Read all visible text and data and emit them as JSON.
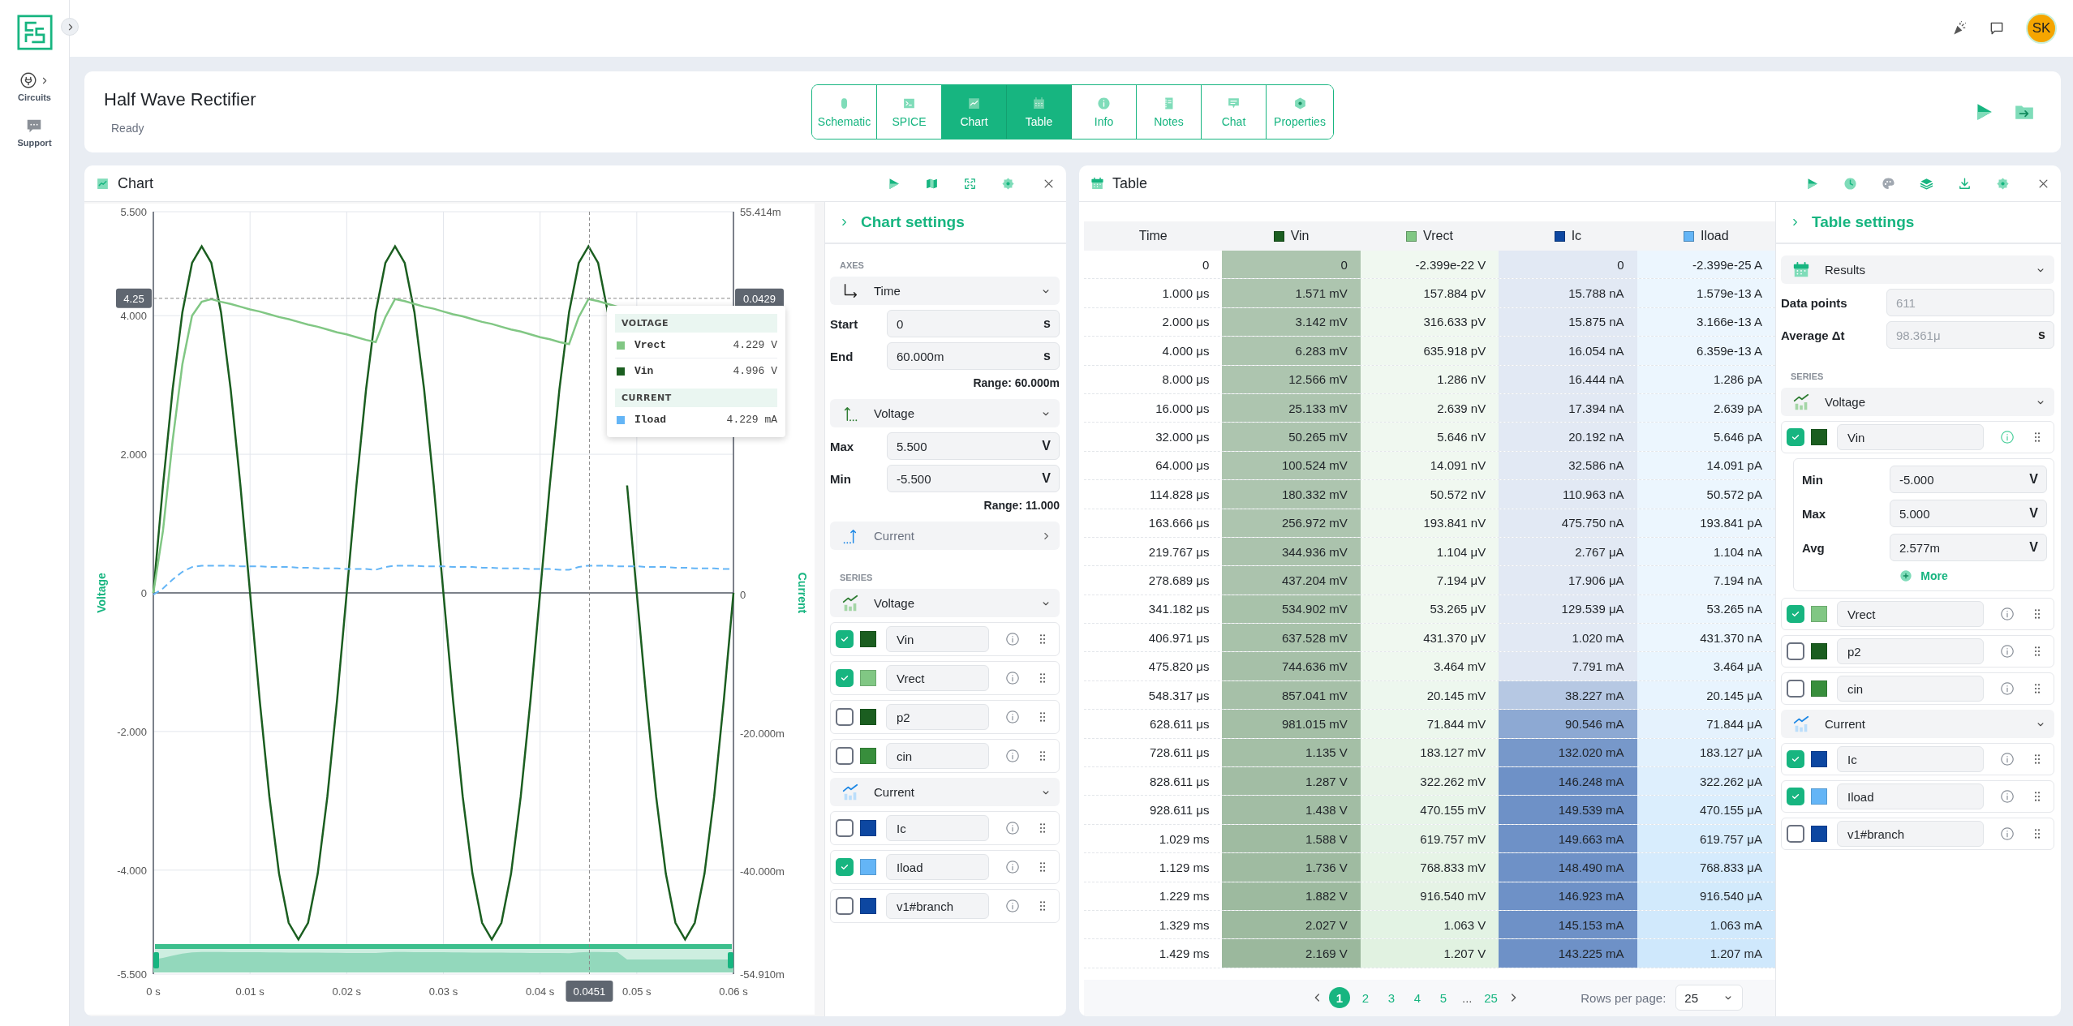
{
  "sidebar": {
    "items": [
      {
        "label": "Circuits",
        "kind": "circuits"
      },
      {
        "label": "Support",
        "kind": "support"
      }
    ]
  },
  "topbar": {
    "avatar": "SK"
  },
  "project": {
    "title": "Half Wave Rectifier",
    "status": "Ready",
    "tabs": [
      {
        "label": "Schematic",
        "selected": false
      },
      {
        "label": "SPICE",
        "selected": false
      },
      {
        "label": "Chart",
        "selected": true
      },
      {
        "label": "Table",
        "selected": true
      },
      {
        "label": "Info",
        "selected": false
      },
      {
        "label": "Notes",
        "selected": false
      },
      {
        "label": "Chat",
        "selected": false
      },
      {
        "label": "Properties",
        "selected": false
      }
    ]
  },
  "chart_panel": {
    "title": "Chart",
    "chart_data": {
      "type": "line",
      "ylabel": "Voltage",
      "y2label": "Current",
      "xlim": [
        0,
        0.06
      ],
      "ylim": [
        -5.5,
        5.5
      ],
      "y2lim": [
        -54.91,
        55.414
      ],
      "xticks": [
        {
          "value": 0,
          "label": "0 s"
        },
        {
          "value": 0.01,
          "label": "0.01 s"
        },
        {
          "value": 0.02,
          "label": "0.02 s"
        },
        {
          "value": 0.03,
          "label": "0.03 s"
        },
        {
          "value": 0.04,
          "label": "0.04 s"
        },
        {
          "value": 0.05,
          "label": "0.05 s"
        },
        {
          "value": 0.06,
          "label": "0.06 s"
        }
      ],
      "yticks": [
        {
          "value": 5.5,
          "label": "5.500"
        },
        {
          "value": 4,
          "label": "4.000"
        },
        {
          "value": 2,
          "label": "2.000"
        },
        {
          "value": 0,
          "label": "0"
        },
        {
          "value": -2,
          "label": "-2.000"
        },
        {
          "value": -4,
          "label": "-4.000"
        },
        {
          "value": -5.5,
          "label": "-5.500"
        }
      ],
      "y2ticks": [
        {
          "value": 55.414,
          "label": "55.414m"
        },
        {
          "value": 0,
          "label": "0"
        },
        {
          "value": -20,
          "label": "-20.000m"
        },
        {
          "value": -40,
          "label": "-40.000m"
        },
        {
          "value": -54.91,
          "label": "-54.910m"
        }
      ],
      "x": [
        0,
        0.001,
        0.002,
        0.003,
        0.004,
        0.005,
        0.006,
        0.007,
        0.008,
        0.009,
        0.01,
        0.011,
        0.012,
        0.013,
        0.014,
        0.015,
        0.016,
        0.017,
        0.018,
        0.019,
        0.02,
        0.021,
        0.022,
        0.023,
        0.024,
        0.025,
        0.026,
        0.027,
        0.028,
        0.029,
        0.03,
        0.031,
        0.032,
        0.033,
        0.034,
        0.035,
        0.036,
        0.037,
        0.038,
        0.039,
        0.04,
        0.041,
        0.042,
        0.043,
        0.044,
        0.045,
        0.046,
        0.047,
        0.048,
        0.049,
        0.05,
        0.051,
        0.052,
        0.053,
        0.054,
        0.055,
        0.056,
        0.057,
        0.058,
        0.059,
        0.06
      ],
      "series": [
        {
          "color": "#1b5e20",
          "values": [
            0,
            1.55,
            2.94,
            4.05,
            4.76,
            5,
            4.76,
            4.05,
            2.94,
            1.55,
            0,
            -1.55,
            -2.94,
            -4.05,
            -4.76,
            -5,
            -4.76,
            -4.05,
            -2.94,
            -1.55,
            0,
            1.55,
            2.94,
            4.05,
            4.76,
            5,
            4.76,
            4.05,
            2.94,
            1.55,
            0,
            -1.55,
            -2.94,
            -4.05,
            -4.76,
            -5,
            -4.76,
            -4.05,
            -2.94,
            -1.55,
            0,
            1.55,
            2.94,
            4.05,
            4.76,
            5,
            4.76,
            4.05,
            null,
            1.55,
            0,
            -1.55,
            -2.94,
            -4.05,
            -4.76,
            -5,
            -4.76,
            -4.05,
            -2.94,
            -1.55,
            0
          ]
        },
        {
          "color": "#81c784",
          "values": [
            0,
            0.9,
            2.2,
            3.3,
            4,
            4.2,
            4.24,
            4.2,
            4.17,
            4.13,
            4.09,
            4.06,
            4.02,
            3.98,
            3.95,
            3.91,
            3.87,
            3.84,
            3.8,
            3.76,
            3.73,
            3.69,
            3.65,
            3.62,
            3.98,
            4.24,
            4.21,
            4.17,
            4.13,
            4.1,
            4.06,
            4.02,
            3.99,
            3.95,
            3.91,
            3.88,
            3.84,
            3.8,
            3.77,
            3.73,
            3.69,
            3.66,
            3.62,
            3.59,
            3.98,
            4.24,
            4.21,
            4.17,
            4.13,
            null,
            null,
            null,
            null,
            null,
            null,
            null,
            null,
            null,
            null,
            null,
            null
          ]
        },
        {
          "color": "#64b5f6",
          "axis": "y2",
          "line_style": "dashed",
          "values": [
            0,
            0.9,
            2.2,
            3.3,
            4,
            4.2,
            4.2,
            4.2,
            4.2,
            4.1,
            4.1,
            4.1,
            4,
            4,
            4,
            3.9,
            3.9,
            3.8,
            3.8,
            3.8,
            3.7,
            3.7,
            3.7,
            3.6,
            4,
            4.2,
            4.2,
            4.2,
            4.1,
            4.1,
            4.1,
            4,
            4,
            4,
            3.9,
            3.9,
            3.8,
            3.8,
            3.8,
            3.7,
            3.7,
            3.7,
            3.6,
            3.6,
            4,
            4.2,
            4.2,
            4.2,
            4.1,
            4.1,
            4.1,
            4,
            4,
            4,
            3.9,
            3.9,
            3.8,
            3.8,
            3.8,
            3.7,
            3.7
          ]
        }
      ],
      "grid": true,
      "ref_lines": [
        {
          "axis": "x",
          "value": 0.0451,
          "label": "0.0451"
        },
        {
          "axis": "y",
          "value": 4.25,
          "label": "4.25"
        }
      ],
      "annotations": [
        "0.0429"
      ]
    },
    "tooltip": {
      "groups": [
        {
          "title": "VOLTAGE",
          "items": [
            {
              "name": "Vrect",
              "value": "4.229 V",
              "color": "#81c784"
            },
            {
              "name": "Vin",
              "value": "4.996 V",
              "color": "#1b5e20"
            }
          ]
        },
        {
          "title": "CURRENT",
          "items": [
            {
              "name": "Iload",
              "value": "4.229 mA",
              "color": "#64b5f6"
            }
          ]
        }
      ]
    },
    "settings": {
      "title": "Chart settings",
      "axes_heading": "AXES",
      "axes": [
        {
          "label": "Time",
          "kind": "time",
          "expanded": true,
          "fields": [
            {
              "label": "Start",
              "value": "0",
              "unit": "s"
            },
            {
              "label": "End",
              "value": "60.000m",
              "unit": "s"
            }
          ],
          "range": "Range: 60.000m"
        },
        {
          "label": "Voltage",
          "kind": "voltage",
          "expanded": true,
          "fields": [
            {
              "label": "Max",
              "value": "5.500",
              "unit": "V"
            },
            {
              "label": "Min",
              "value": "-5.500",
              "unit": "V"
            }
          ],
          "range": "Range: 11.000"
        },
        {
          "label": "Current",
          "kind": "current",
          "expanded": false
        }
      ],
      "series_heading": "SERIES",
      "series_groups": [
        {
          "label": "Voltage",
          "kind": "voltage",
          "series": [
            {
              "name": "Vin",
              "checked": true,
              "color": "#1b5e20"
            },
            {
              "name": "Vrect",
              "checked": true,
              "color": "#81c784"
            },
            {
              "name": "p2",
              "checked": false,
              "color": "#1b5e20"
            },
            {
              "name": "cin",
              "checked": false,
              "color": "#388e3c"
            }
          ]
        },
        {
          "label": "Current",
          "kind": "current",
          "series": [
            {
              "name": "Ic",
              "checked": false,
              "color": "#0d47a1"
            },
            {
              "name": "Iload",
              "checked": true,
              "color": "#64b5f6"
            },
            {
              "name": "v1#branch",
              "checked": false,
              "color": "#0d47a1"
            }
          ]
        }
      ]
    }
  },
  "table_panel": {
    "title": "Table",
    "table": {
      "time_column": "Time",
      "columns": [
        {
          "label": "Vin",
          "color": "#1b5e20"
        },
        {
          "label": "Vrect",
          "color": "#81c784"
        },
        {
          "label": "Ic",
          "color": "#0d47a1"
        },
        {
          "label": "Iload",
          "color": "#64b5f6"
        }
      ],
      "rows": [
        {
          "time": "0",
          "cells": [
            {
              "text": "0",
              "color": "#adc5af"
            },
            {
              "text": "-2.399e-22 V",
              "color": "#f0f8f0"
            },
            {
              "text": "0",
              "color": "#e2e9f4"
            },
            {
              "text": "-2.399e-25 A",
              "color": "#ecf6fe"
            }
          ]
        },
        {
          "time": "1.000 μs",
          "cells": [
            {
              "text": "1.571 mV",
              "color": "#adc5af"
            },
            {
              "text": "157.884 pV",
              "color": "#f0f8f0"
            },
            {
              "text": "15.788 nA",
              "color": "#e2e9f4"
            },
            {
              "text": "1.579e-13 A",
              "color": "#ecf6fe"
            }
          ]
        },
        {
          "time": "2.000 μs",
          "cells": [
            {
              "text": "3.142 mV",
              "color": "#adc5af"
            },
            {
              "text": "316.633 pV",
              "color": "#f0f8f0"
            },
            {
              "text": "15.875 nA",
              "color": "#e2e9f4"
            },
            {
              "text": "3.166e-13 A",
              "color": "#ecf6fe"
            }
          ]
        },
        {
          "time": "4.000 μs",
          "cells": [
            {
              "text": "6.283 mV",
              "color": "#adc5af"
            },
            {
              "text": "635.918 pV",
              "color": "#f0f8f0"
            },
            {
              "text": "16.054 nA",
              "color": "#e2e9f4"
            },
            {
              "text": "6.359e-13 A",
              "color": "#ecf6fe"
            }
          ]
        },
        {
          "time": "8.000 μs",
          "cells": [
            {
              "text": "12.566 mV",
              "color": "#adc5af"
            },
            {
              "text": "1.286 nV",
              "color": "#f0f8f0"
            },
            {
              "text": "16.444 nA",
              "color": "#e2e9f4"
            },
            {
              "text": "1.286 pA",
              "color": "#ecf6fe"
            }
          ]
        },
        {
          "time": "16.000 μs",
          "cells": [
            {
              "text": "25.133 mV",
              "color": "#adc5af"
            },
            {
              "text": "2.639 nV",
              "color": "#f0f8f0"
            },
            {
              "text": "17.394 nA",
              "color": "#e2e9f4"
            },
            {
              "text": "2.639 pA",
              "color": "#ecf6fe"
            }
          ]
        },
        {
          "time": "32.000 μs",
          "cells": [
            {
              "text": "50.265 mV",
              "color": "#adc5af"
            },
            {
              "text": "5.646 nV",
              "color": "#f0f8f0"
            },
            {
              "text": "20.192 nA",
              "color": "#e2e9f4"
            },
            {
              "text": "5.646 pA",
              "color": "#ecf6fe"
            }
          ]
        },
        {
          "time": "64.000 μs",
          "cells": [
            {
              "text": "100.524 mV",
              "color": "#adc5af"
            },
            {
              "text": "14.091 nV",
              "color": "#f0f8f0"
            },
            {
              "text": "32.586 nA",
              "color": "#e2e9f4"
            },
            {
              "text": "14.091 pA",
              "color": "#ecf6fe"
            }
          ]
        },
        {
          "time": "114.828 μs",
          "cells": [
            {
              "text": "180.332 mV",
              "color": "#adc5af"
            },
            {
              "text": "50.572 nV",
              "color": "#f0f8f0"
            },
            {
              "text": "110.963 nA",
              "color": "#e2e9f4"
            },
            {
              "text": "50.572 pA",
              "color": "#ecf6fe"
            }
          ]
        },
        {
          "time": "163.666 μs",
          "cells": [
            {
              "text": "256.972 mV",
              "color": "#adc5af"
            },
            {
              "text": "193.841 nV",
              "color": "#f0f8f0"
            },
            {
              "text": "475.750 nA",
              "color": "#e2e9f4"
            },
            {
              "text": "193.841 pA",
              "color": "#ecf6fe"
            }
          ]
        },
        {
          "time": "219.767 μs",
          "cells": [
            {
              "text": "344.936 mV",
              "color": "#abc3ad"
            },
            {
              "text": "1.104 μV",
              "color": "#f0f8f0"
            },
            {
              "text": "2.767 μA",
              "color": "#e2e9f4"
            },
            {
              "text": "1.104 nA",
              "color": "#ecf6fe"
            }
          ]
        },
        {
          "time": "278.689 μs",
          "cells": [
            {
              "text": "437.204 mV",
              "color": "#abc3ad"
            },
            {
              "text": "7.194 μV",
              "color": "#f0f8f0"
            },
            {
              "text": "17.906 μA",
              "color": "#e2e9f4"
            },
            {
              "text": "7.194 nA",
              "color": "#ecf6fe"
            }
          ]
        },
        {
          "time": "341.182 μs",
          "cells": [
            {
              "text": "534.902 mV",
              "color": "#a8c2aa"
            },
            {
              "text": "53.265 μV",
              "color": "#f0f8f0"
            },
            {
              "text": "129.539 μA",
              "color": "#e2e9f4"
            },
            {
              "text": "53.265 nA",
              "color": "#ecf6fe"
            }
          ]
        },
        {
          "time": "406.971 μs",
          "cells": [
            {
              "text": "637.528 mV",
              "color": "#a8c2aa"
            },
            {
              "text": "431.370 μV",
              "color": "#f0f8f0"
            },
            {
              "text": "1.020 mA",
              "color": "#e2e9f4"
            },
            {
              "text": "431.370 nA",
              "color": "#ecf6fe"
            }
          ]
        },
        {
          "time": "475.820 μs",
          "cells": [
            {
              "text": "744.636 mV",
              "color": "#a6c0a8"
            },
            {
              "text": "3.464 mV",
              "color": "#eff8ef"
            },
            {
              "text": "7.791 mA",
              "color": "#e0e7f3"
            },
            {
              "text": "3.464 μA",
              "color": "#e9f5fe"
            }
          ]
        },
        {
          "time": "548.317 μs",
          "cells": [
            {
              "text": "857.041 mV",
              "color": "#a6c0a8"
            },
            {
              "text": "20.145 mV",
              "color": "#edf7ee"
            },
            {
              "text": "38.227 mA",
              "color": "#b6c8e3"
            },
            {
              "text": "20.145 μA",
              "color": "#e8f4fe"
            }
          ]
        },
        {
          "time": "628.611 μs",
          "cells": [
            {
              "text": "981.015 mV",
              "color": "#a4bfa6"
            },
            {
              "text": "71.844 mV",
              "color": "#ecf7ed"
            },
            {
              "text": "90.546 mA",
              "color": "#8da9d3"
            },
            {
              "text": "71.844 μA",
              "color": "#e5f2fd"
            }
          ]
        },
        {
          "time": "728.611 μs",
          "cells": [
            {
              "text": "1.135 V",
              "color": "#a4bfa6"
            },
            {
              "text": "183.127 mV",
              "color": "#ebf6eb"
            },
            {
              "text": "132.020 mA",
              "color": "#7798ca"
            },
            {
              "text": "183.127 μA",
              "color": "#e2f1fd"
            }
          ]
        },
        {
          "time": "828.611 μs",
          "cells": [
            {
              "text": "1.287 V",
              "color": "#a2bda4"
            },
            {
              "text": "322.262 mV",
              "color": "#eaf5ea"
            },
            {
              "text": "146.248 mA",
              "color": "#6e91c7"
            },
            {
              "text": "322.262 μA",
              "color": "#deeffd"
            }
          ]
        },
        {
          "time": "928.611 μs",
          "cells": [
            {
              "text": "1.438 V",
              "color": "#a2bda4"
            },
            {
              "text": "470.155 mV",
              "color": "#e8f5e9"
            },
            {
              "text": "149.539 mA",
              "color": "#6e91c7"
            },
            {
              "text": "470.155 μA",
              "color": "#dbeefd"
            }
          ]
        },
        {
          "time": "1.029 ms",
          "cells": [
            {
              "text": "1.588 V",
              "color": "#9fbba1"
            },
            {
              "text": "619.757 mV",
              "color": "#e7f4e8"
            },
            {
              "text": "149.663 mA",
              "color": "#6e91c7"
            },
            {
              "text": "619.757 μA",
              "color": "#d8edfd"
            }
          ]
        },
        {
          "time": "1.129 ms",
          "cells": [
            {
              "text": "1.736 V",
              "color": "#9fbba1"
            },
            {
              "text": "768.833 mV",
              "color": "#e6f4e6"
            },
            {
              "text": "148.490 mA",
              "color": "#6e91c7"
            },
            {
              "text": "768.833 μA",
              "color": "#d5ebfd"
            }
          ]
        },
        {
          "time": "1.229 ms",
          "cells": [
            {
              "text": "1.882 V",
              "color": "#9dba9f"
            },
            {
              "text": "916.540 mV",
              "color": "#e5f3e5"
            },
            {
              "text": "146.923 mA",
              "color": "#6e91c7"
            },
            {
              "text": "916.540 μA",
              "color": "#d2eafc"
            }
          ]
        },
        {
          "time": "1.329 ms",
          "cells": [
            {
              "text": "2.027 V",
              "color": "#9dba9f"
            },
            {
              "text": "1.063 V",
              "color": "#e3f3e4"
            },
            {
              "text": "145.153 mA",
              "color": "#6e91c7"
            },
            {
              "text": "1.063 mA",
              "color": "#d1e9fc"
            }
          ]
        },
        {
          "time": "1.429 ms",
          "cells": [
            {
              "text": "2.169 V",
              "color": "#9bb89d"
            },
            {
              "text": "1.207 V",
              "color": "#e1f2e1"
            },
            {
              "text": "143.225 mA",
              "color": "#6e91c7"
            },
            {
              "text": "1.207 mA",
              "color": "#cfe8fc"
            }
          ]
        }
      ]
    },
    "pagination": {
      "pages": [
        {
          "label": "1",
          "kind": "page",
          "selected": true
        },
        {
          "label": "2",
          "kind": "page",
          "selected": false
        },
        {
          "label": "3",
          "kind": "page",
          "selected": false
        },
        {
          "label": "4",
          "kind": "page",
          "selected": false
        },
        {
          "label": "5",
          "kind": "page",
          "selected": false
        },
        {
          "label": "...",
          "kind": "ellipsis"
        },
        {
          "label": "25",
          "kind": "page",
          "selected": false
        }
      ],
      "rows_per_page_label": "Rows per page:",
      "rows_per_page": "25"
    },
    "settings": {
      "title": "Table settings",
      "source": "Results",
      "fields": [
        {
          "label": "Data points",
          "value": "611",
          "disabled": true
        },
        {
          "label": "Average Δt",
          "value": "98.361μ",
          "unit": "s",
          "disabled": true
        }
      ],
      "series_heading": "SERIES",
      "series_groups": [
        {
          "label": "Voltage",
          "kind": "voltage",
          "series": [
            {
              "name": "Vin",
              "checked": true,
              "color": "#1b5e20",
              "expanded": true,
              "stats": [
                {
                  "label": "Min",
                  "value": "-5.000",
                  "unit": "V"
                },
                {
                  "label": "Max",
                  "value": "5.000",
                  "unit": "V"
                },
                {
                  "label": "Avg",
                  "value": "2.577m",
                  "unit": "V"
                }
              ],
              "more": "More"
            },
            {
              "name": "Vrect",
              "checked": true,
              "color": "#81c784",
              "expanded": false
            },
            {
              "name": "p2",
              "checked": false,
              "color": "#1b5e20",
              "expanded": false
            },
            {
              "name": "cin",
              "checked": false,
              "color": "#388e3c",
              "expanded": false
            }
          ]
        },
        {
          "label": "Current",
          "kind": "current",
          "series": [
            {
              "name": "Ic",
              "checked": true,
              "color": "#0d47a1",
              "expanded": false
            },
            {
              "name": "Iload",
              "checked": true,
              "color": "#64b5f6",
              "expanded": false
            },
            {
              "name": "v1#branch",
              "checked": false,
              "color": "#0d47a1",
              "expanded": false
            }
          ]
        }
      ]
    }
  }
}
